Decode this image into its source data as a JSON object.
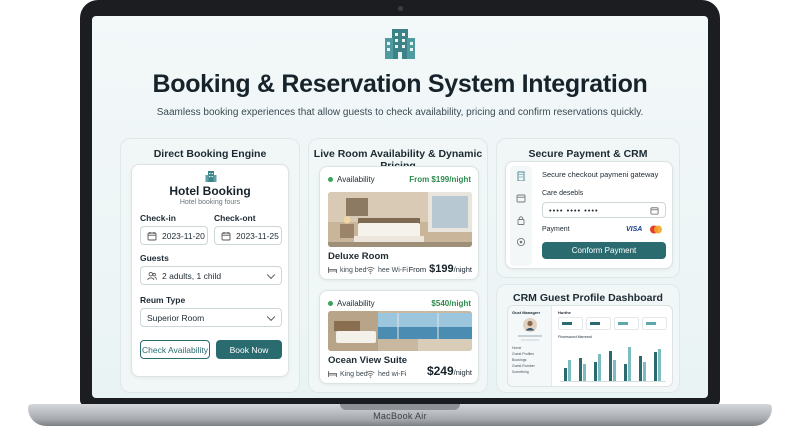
{
  "laptop": {
    "brand": "MacBook Air"
  },
  "header": {
    "title": "Booking & Reservation System Integration",
    "subtitle": "Saamless booking experiences that allow guests to check availability, pricing and confirm reservations quickly."
  },
  "booking_engine": {
    "panel_title": "Direct Booking Engine",
    "form_title": "Hotel Booking",
    "form_subtitle": "Hotel booking fours",
    "checkin_label": "Check-in",
    "checkin_value": "2023-11-20",
    "checkout_label": "Check-ont",
    "checkout_value": "2023-11-25",
    "guests_label": "Guests",
    "guests_value": "2 adults, 1 child",
    "room_type_label": "Reum Type",
    "room_type_value": "Superior Room",
    "check_button": "Check Availability",
    "book_button": "Book Now"
  },
  "availability": {
    "panel_title": "Live Room Availability & Dynamic Pricing",
    "rooms": [
      {
        "status": "Availability",
        "price_top": "From $199/night",
        "name": "Deluxe Room",
        "amenity_1": "king bed",
        "amenity_2": "hee Wi-Fi",
        "price_prefix": "From",
        "price": "$199",
        "price_suffix": "/night"
      },
      {
        "status": "Availability",
        "price_top": "$540/night",
        "name": "Ocean View Suite",
        "amenity_1": "King bed",
        "amenity_2": "hed wi-Fi",
        "price": "$249",
        "price_suffix": "/night"
      }
    ]
  },
  "payment": {
    "panel_title": "Secure Payment & CRM Connectivity",
    "gateway_text": "Secure checkout paymeni gateway",
    "card_label": "Care desebls",
    "card_value": "•••• •••• ••••",
    "payment_label": "Payment",
    "visa": "VISA",
    "confirm_button": "Conform Payment"
  },
  "crm": {
    "panel_title": "CRM Guest Profile Dashboard",
    "sidebar_title": "Gust Managerr",
    "top_title": "Hurthe",
    "section_title": "Fhuersaurct Marreard",
    "menu": [
      "Home",
      "Guest Profiles",
      "Bookings",
      "Guest Rumber",
      "Something"
    ],
    "bars": [
      [
        0.35,
        0.55
      ],
      [
        0.6,
        0.45
      ],
      [
        0.5,
        0.7
      ],
      [
        0.8,
        0.55
      ],
      [
        0.45,
        0.9
      ],
      [
        0.65,
        0.5
      ],
      [
        0.75,
        0.85
      ]
    ]
  },
  "colors": {
    "accent": "#2a6b70",
    "success": "#2d8a4e",
    "background": "#eef5f6"
  }
}
